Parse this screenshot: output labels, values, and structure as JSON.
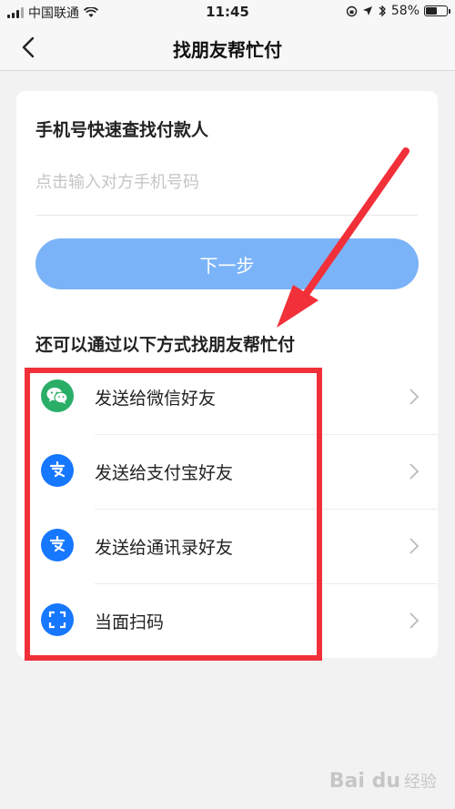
{
  "status_bar": {
    "carrier": "中国联通",
    "time": "11:45",
    "battery_percent": "58%",
    "battery_level": 0.58
  },
  "nav": {
    "title": "找朋友帮忙付",
    "back_icon": "chevron-left-icon"
  },
  "phone_search": {
    "title": "手机号快速查找付款人",
    "placeholder": "点击输入对方手机号码",
    "value": "",
    "next_label": "下一步"
  },
  "other_methods": {
    "title": "还可以通过以下方式找朋友帮忙付",
    "options": [
      {
        "label": "发送给微信好友",
        "icon": "wechat-icon",
        "color": "#2aae67"
      },
      {
        "label": "发送给支付宝好友",
        "icon": "alipay-icon",
        "color": "#1677ff"
      },
      {
        "label": "发送给通讯录好友",
        "icon": "alipay-icon",
        "color": "#1677ff"
      },
      {
        "label": "当面扫码",
        "icon": "scan-icon",
        "color": "#1677ff"
      }
    ]
  },
  "colors": {
    "button": "#7bb3f8",
    "annotation_red": "#f1303a"
  },
  "watermark": {
    "logo": "Bai du",
    "sub": "经验"
  }
}
